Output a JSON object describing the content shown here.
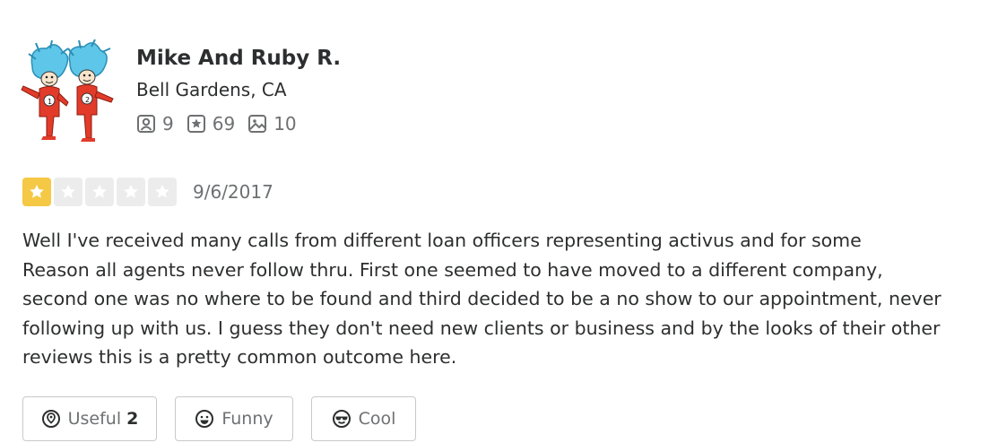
{
  "user": {
    "name": "Mike And Ruby R.",
    "location": "Bell Gardens, CA",
    "stats": {
      "friends": "9",
      "reviews": "69",
      "photos": "10"
    }
  },
  "review": {
    "rating": 1,
    "rating_max": 5,
    "date": "9/6/2017",
    "lines": [
      "Well I've received many calls from different loan officers representing activus and for some",
      "Reason all agents never follow thru. First one seemed to have moved to a different company,",
      "second one was no where to be found and third decided to be a no show to our appointment, never",
      "following up with us. I guess they don't need new clients or business and by the looks of their other",
      "reviews this is a pretty common outcome here."
    ]
  },
  "actions": {
    "useful_label": "Useful",
    "useful_count": "2",
    "funny_label": "Funny",
    "cool_label": "Cool"
  },
  "colors": {
    "star_filled": "#f5c845",
    "star_empty": "#ececec",
    "text": "#2d2e2f",
    "muted": "#6e7072"
  },
  "icons": [
    "friends-icon",
    "review-star-icon",
    "photo-icon",
    "useful-icon",
    "funny-icon",
    "cool-icon"
  ]
}
